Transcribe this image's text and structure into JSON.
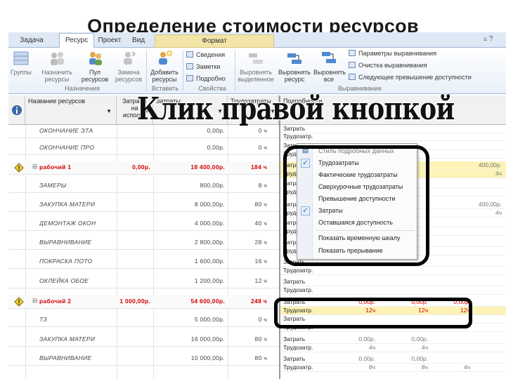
{
  "title": "Определение стоимости ресурсов",
  "caption": "Клик правой кнопкой",
  "tabs": [
    {
      "label": "Задача"
    },
    {
      "label": "Ресурс"
    },
    {
      "label": "Проект"
    },
    {
      "label": "Вид"
    },
    {
      "label": "Формат"
    }
  ],
  "ribbon": {
    "btn_groups": "Группы",
    "btn_assign": "Назначить ресурсы",
    "btn_pool": "Пул ресурсов",
    "btn_replace": "Замена ресурсов",
    "btn_add": "Добавить ресурсы",
    "btn_info": "Сведения",
    "btn_notes": "Заметки",
    "btn_details": "Подробно",
    "btn_level_sel": "Выровнять выделенное",
    "btn_level_res": "Выровнять ресурс",
    "btn_level_all": "Выровнять все",
    "btn_level_opts": "Параметры выравнивания",
    "btn_level_clear": "Очистка выравнивания",
    "btn_next_overalloc": "Следующее превышение доступности",
    "grp_assign": "Назначения",
    "grp_insert": "Вставить",
    "grp_props": "Свойства",
    "grp_level": "Выравнивание"
  },
  "columns": {
    "name": "Название ресурсов",
    "cost_label_1": "Затраты",
    "cost_label_2": "на",
    "cost_label_3": "использ",
    "cost": "Затраты",
    "work": "Трудозатраты",
    "details": "Подробности"
  },
  "rows": [
    {
      "name": "ОКОНЧАНИЕ ЭТА",
      "c1": "",
      "c2": "0,00р.",
      "c3": "0 ч"
    },
    {
      "name": "ОКОНЧАНИЕ ПРО",
      "c1": "",
      "c2": "0,00р.",
      "c3": "0 ч"
    },
    {
      "name": "рабочий 1",
      "c1": "0,00р.",
      "c2": "18 400,00р.",
      "c3": "184 ч"
    },
    {
      "name": "ЗАМЕРЫ",
      "c1": "",
      "c2": "800,00р.",
      "c3": "8 ч"
    },
    {
      "name": "ЗАКУПКА МАТЕРИ",
      "c1": "",
      "c2": "8 000,00р.",
      "c3": "80 ч"
    },
    {
      "name": "ДЕМОНТАЖ ОКОН",
      "c1": "",
      "c2": "4 000,00р.",
      "c3": "40 ч"
    },
    {
      "name": "ВЫРАВНИВАНИЕ",
      "c1": "",
      "c2": "2 800,00р.",
      "c3": "28 ч"
    },
    {
      "name": "ПОКРАСКА ПОТО",
      "c1": "",
      "c2": "1 600,00р.",
      "c3": "16 ч"
    },
    {
      "name": "ОКЛЕЙКА ОБОЕ",
      "c1": "",
      "c2": "1 200,00р.",
      "c3": "12 ч"
    },
    {
      "name": "рабочий 2",
      "c1": "1 000,00р.",
      "c2": "54 600,00р.",
      "c3": "248 ч"
    },
    {
      "name": "ТЗ",
      "c1": "",
      "c2": "5 000,00р.",
      "c3": "0 ч"
    },
    {
      "name": "ЗАКУПКА МАТЕРИ",
      "c1": "",
      "c2": "16 000,00р.",
      "c3": "80 ч"
    },
    {
      "name": "ВЫРАВНИВАНИЕ",
      "c1": "",
      "c2": "10 000,00р.",
      "c3": "80 ч"
    }
  ],
  "detail_labels": {
    "cost": "Затрать",
    "work": "Трудозатр."
  },
  "detail_values": {
    "v400": "400,00р.",
    "v4h": "4ч",
    "w1_cost_a": "0,00р.",
    "w1_cost_b": "0,00р.",
    "w1_cost_c": "0,00р.",
    "w1_work_a": "12ч",
    "w1_work_b": "12ч",
    "w1_work_c": "12ч",
    "r_cost_a": "0,00р.",
    "r_cost_b": "0,00р.",
    "r_work_a": "4ч",
    "r_work_b": "4ч",
    "r2_cost_a": "0,00р.",
    "r2_cost_b": "0,00р.",
    "r2_work_a": "8ч",
    "r2_work_b": "8ч",
    "r2_work_c": "4ч"
  },
  "context_menu": [
    {
      "label": "Стиль подробных данных",
      "checked": false
    },
    {
      "label": "Трудозатраты",
      "checked": true
    },
    {
      "label": "Фактические трудозатраты",
      "checked": false
    },
    {
      "label": "Сверхурочные трудозатраты",
      "checked": false
    },
    {
      "label": "Превышение доступности",
      "checked": false
    },
    {
      "label": "Затраты",
      "checked": true
    },
    {
      "label": "Оставшаяся доступность",
      "checked": false
    },
    {
      "label": "Показать временную шкалу",
      "checked": false
    },
    {
      "label": "Показать прерывание",
      "checked": false
    }
  ],
  "colors": {
    "accent_red": "#d40000",
    "highlight_yellow": "#fdf3b6"
  }
}
